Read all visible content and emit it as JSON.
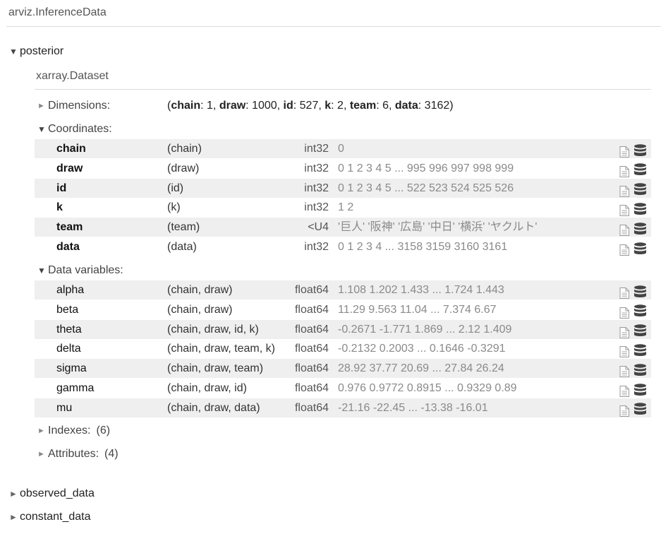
{
  "title": "arviz.InferenceData",
  "groups": {
    "posterior": {
      "label": "posterior",
      "expanded": true
    },
    "observed_data": {
      "label": "observed_data",
      "expanded": false
    },
    "constant_data": {
      "label": "constant_data",
      "expanded": false
    }
  },
  "dataset": {
    "title": "xarray.Dataset",
    "dimensions": {
      "label": "Dimensions:",
      "items": [
        {
          "name": "chain",
          "value": "1"
        },
        {
          "name": "draw",
          "value": "1000"
        },
        {
          "name": "id",
          "value": "527"
        },
        {
          "name": "k",
          "value": "2"
        },
        {
          "name": "team",
          "value": "6"
        },
        {
          "name": "data",
          "value": "3162"
        }
      ]
    },
    "coordinates": {
      "label": "Coordinates:",
      "rows": [
        {
          "name": "chain",
          "dims": "(chain)",
          "dtype": "int32",
          "preview": "0"
        },
        {
          "name": "draw",
          "dims": "(draw)",
          "dtype": "int32",
          "preview": "0 1 2 3 4 5 ... 995 996 997 998 999"
        },
        {
          "name": "id",
          "dims": "(id)",
          "dtype": "int32",
          "preview": "0 1 2 3 4 5 ... 522 523 524 525 526"
        },
        {
          "name": "k",
          "dims": "(k)",
          "dtype": "int32",
          "preview": "1 2"
        },
        {
          "name": "team",
          "dims": "(team)",
          "dtype": "<U4",
          "preview": "'巨人' '阪神' '広島' '中日' '横浜' 'ヤクルト'"
        },
        {
          "name": "data",
          "dims": "(data)",
          "dtype": "int32",
          "preview": "0 1 2 3 4 ... 3158 3159 3160 3161"
        }
      ]
    },
    "data_variables": {
      "label": "Data variables:",
      "rows": [
        {
          "name": "alpha",
          "dims": "(chain, draw)",
          "dtype": "float64",
          "preview": "1.108 1.202 1.433 ... 1.724 1.443"
        },
        {
          "name": "beta",
          "dims": "(chain, draw)",
          "dtype": "float64",
          "preview": "11.29 9.563 11.04 ... 7.374 6.67"
        },
        {
          "name": "theta",
          "dims": "(chain, draw, id, k)",
          "dtype": "float64",
          "preview": "-0.2671 -1.771 1.869 ... 2.12 1.409"
        },
        {
          "name": "delta",
          "dims": "(chain, draw, team, k)",
          "dtype": "float64",
          "preview": "-0.2132 0.2003 ... 0.1646 -0.3291"
        },
        {
          "name": "sigma",
          "dims": "(chain, draw, team)",
          "dtype": "float64",
          "preview": "28.92 37.77 20.69 ... 27.84 26.24"
        },
        {
          "name": "gamma",
          "dims": "(chain, draw, id)",
          "dtype": "float64",
          "preview": "0.976 0.9772 0.8915 ... 0.9329 0.89"
        },
        {
          "name": "mu",
          "dims": "(chain, draw, data)",
          "dtype": "float64",
          "preview": "-21.16 -22.45 ... -13.38 -16.01"
        }
      ]
    },
    "indexes": {
      "label": "Indexes:",
      "count": "(6)"
    },
    "attributes": {
      "label": "Attributes:",
      "count": "(4)"
    }
  },
  "icons": {
    "attrs": "file-text-icon",
    "data": "database-icon"
  }
}
